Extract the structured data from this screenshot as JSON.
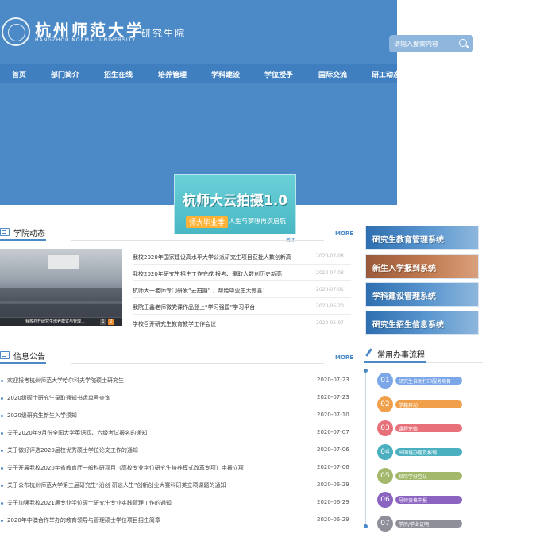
{
  "header": {
    "logo_cn": "杭州师范大学",
    "logo_en": "HANGZHOU NORMAL UNIVERSITY",
    "subtitle": "研究生院",
    "search_placeholder": "请输入搜索内容"
  },
  "nav": [
    "首页",
    "部门简介",
    "招生在线",
    "培养管理",
    "学科建设",
    "学位授予",
    "国际交流",
    "研工动态"
  ],
  "ad": {
    "title": "杭师大云拍摄1.0",
    "tag": "师大毕业季",
    "subtitle": "人生与梦想再次启航",
    "close": "关闭"
  },
  "news": {
    "heading": "学院动态",
    "more": "MORE",
    "photo_caption": "我校召开研究生培养模式与管理...",
    "photo_pager": [
      "1",
      "2"
    ],
    "items": [
      {
        "title": "我校2020年国家建设高水平大学公派研究生项目获批人数创新高",
        "date": "2020-07-08"
      },
      {
        "title": "我校2020年研究生招生工作完成 报考、录取人数创历史新高",
        "date": "2020-07-03"
      },
      {
        "title": "杭师大一老师专门研发“云拍摄” ，帮给毕业生大惊喜！",
        "date": "2020-07-01"
      },
      {
        "title": "我院王鑫老师微党课作品登上“学习强国”学习平台",
        "date": "2020-05-20"
      },
      {
        "title": "学校召开研究生教育教学工作会议",
        "date": "2020-05-07"
      }
    ]
  },
  "notices": {
    "heading": "信息公告",
    "more": "MORE",
    "items": [
      {
        "title": "欢迎报考杭州师范大学哈尔科夫学院硕士研究生",
        "date": "2020-07-23"
      },
      {
        "title": "2020级硕士研究生录取通知书运单号查询",
        "date": "2020-07-23"
      },
      {
        "title": "2020级研究生新生入学须知",
        "date": "2020-07-10"
      },
      {
        "title": "关于2020年9月份全国大学英语四、六级考试报名的通知",
        "date": "2020-07-07"
      },
      {
        "title": "关于做好评选2020届校优秀硕士学位论文工作的通知",
        "date": "2020-07-06"
      },
      {
        "title": "关于开展我校2020年省教育厅一般科研项目（高校专业学位研究生培养模式改革专项）申报立项",
        "date": "2020-07-06"
      },
      {
        "title": "关于公布杭州师范大学第三届研究生“沿创·研途人生”创新创业大赛科研类立项课题的通知",
        "date": "2020-06-29"
      },
      {
        "title": "关于加强我校2021届专业学位硕士研究生专业实践管理工作的通知",
        "date": "2020-06-29"
      },
      {
        "title": "2020年中澳合作举办的教育领导与管理硕士学位项目招生简章",
        "date": "2020-06-29"
      }
    ]
  },
  "systems": [
    {
      "label": "研究生教育管理系统",
      "color": "blue"
    },
    {
      "label": "新生入学报到系统",
      "color": "brown"
    },
    {
      "label": "学科建设管理系统",
      "color": "blue"
    },
    {
      "label": "研究生招生信息系统",
      "color": "blue"
    }
  ],
  "process": {
    "heading": "常用办事流程",
    "steps": [
      {
        "num": "01",
        "label": "研究生自助打印服务项目",
        "color": "#7ba7e8"
      },
      {
        "num": "02",
        "label": "学籍异动",
        "color": "#f0a04b"
      },
      {
        "num": "03",
        "label": "课程免修",
        "color": "#e8707a"
      },
      {
        "num": "04",
        "label": "出国境办理及报销",
        "color": "#4aafbf"
      },
      {
        "num": "05",
        "label": "校际学分互认",
        "color": "#a3b86b"
      },
      {
        "num": "06",
        "label": "导师资格申报",
        "color": "#8b63c0"
      },
      {
        "num": "07",
        "label": "学历/学业证明",
        "color": "#8f8f9a"
      }
    ]
  }
}
